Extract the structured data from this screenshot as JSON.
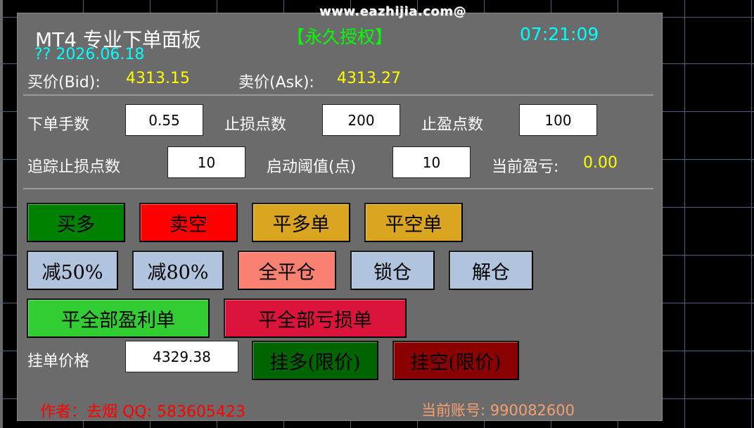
{
  "watermark": "www.eazhijia.com@",
  "header": {
    "title": "MT4 专业下单面板",
    "license": "【永久授权】",
    "time": "07:21:09",
    "date": "?? 2026.06.18"
  },
  "quotes": {
    "bid_label": "买价(Bid):",
    "bid_value": "4313.15",
    "ask_label": "卖价(Ask):",
    "ask_value": "4313.27"
  },
  "params": {
    "lots_label": "下单手数",
    "lots_value": "0.55",
    "sl_label": "止损点数",
    "sl_value": "200",
    "tp_label": "止盈点数",
    "tp_value": "100",
    "trailing_label": "追踪止损点数",
    "trailing_value": "10",
    "trigger_label": "启动阈值(点)",
    "trigger_value": "10",
    "pnl_label": "当前盈亏:",
    "pnl_value": "0.00"
  },
  "buttons": {
    "buy": "买多",
    "sell": "卖空",
    "close_buy": "平多单",
    "close_sell": "平空单",
    "reduce50": "减50%",
    "reduce80": "减80%",
    "close_all": "全平仓",
    "lock": "锁仓",
    "unlock": "解仓",
    "close_profit": "平全部盈利单",
    "close_loss": "平全部亏损单",
    "buy_limit": "挂多(限价)",
    "sell_limit": "挂空(限价)"
  },
  "pending": {
    "label": "挂单价格",
    "value": "4329.38"
  },
  "footer": {
    "author": "作者：去烟 QQ: 583605423",
    "account": "当前账号: 990082600"
  },
  "colors": {
    "panel_bg": "#6b6b6b",
    "buy": "#008000",
    "sell": "#ff0000",
    "close_order": "#daa520",
    "light_steel": "#b0c4de",
    "salmon": "#fa8072",
    "lime_green": "#32cd32",
    "crimson": "#dc143c",
    "dark_green": "#006400",
    "dark_red": "#8b0000"
  }
}
